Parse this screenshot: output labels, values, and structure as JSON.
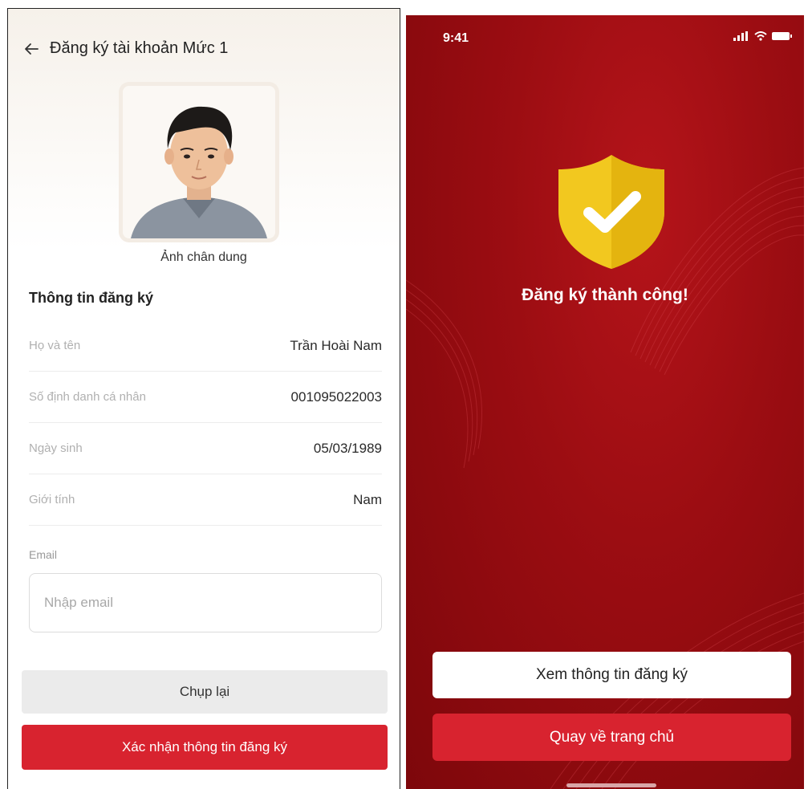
{
  "left_screen": {
    "header": {
      "title": "Đăng ký tài khoản Mức 1"
    },
    "portrait_label": "Ảnh chân dung",
    "section_title": "Thông tin đăng ký",
    "fields": [
      {
        "label": "Họ và tên",
        "value": "Trần Hoài Nam"
      },
      {
        "label": "Số định danh cá nhân",
        "value": "001095022003"
      },
      {
        "label": "Ngày sinh",
        "value": "05/03/1989"
      },
      {
        "label": "Giới tính",
        "value": "Nam"
      }
    ],
    "email": {
      "label": "Email",
      "placeholder": "Nhập email",
      "value": ""
    },
    "buttons": {
      "retake": "Chụp lại",
      "confirm": "Xác nhận thông tin đăng ký"
    }
  },
  "right_screen": {
    "status_bar": {
      "time": "9:41"
    },
    "success_title": "Đăng ký thành công!",
    "buttons": {
      "view_info": "Xem thông tin đăng ký",
      "go_home": "Quay về trang chủ"
    }
  },
  "icons": [
    "arrow-left-icon",
    "cellular-signal-icon",
    "wifi-icon",
    "battery-icon",
    "shield-check-icon"
  ],
  "colors": {
    "brand_red": "#d8232f",
    "background_red": "#9c0d12",
    "shield_yellow": "#f2c81f"
  }
}
